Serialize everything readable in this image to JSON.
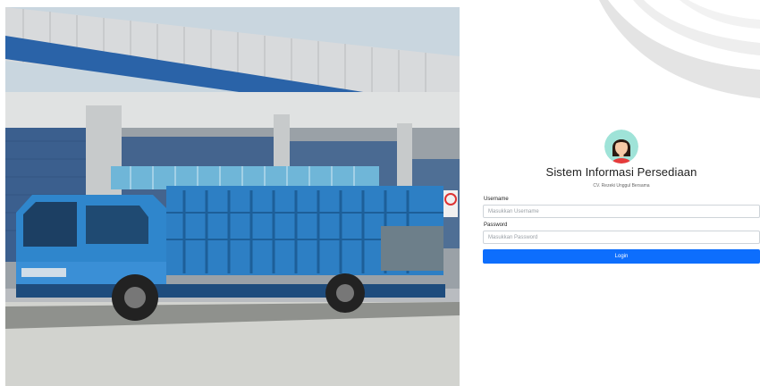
{
  "photo": {
    "alt_icon": "truck-warehouse-photo"
  },
  "app": {
    "title": "Sistem Informasi Persediaan",
    "company": "CV. Rezeki Unggul Bersama"
  },
  "form": {
    "username_label": "Username",
    "username_placeholder": "Masukkan Username",
    "password_label": "Password",
    "password_placeholder": "Masukkan Password",
    "login_label": "Login"
  },
  "colors": {
    "primary": "#0d6efd",
    "truck": "#2d7fc4",
    "border": "#cfd4d9"
  }
}
